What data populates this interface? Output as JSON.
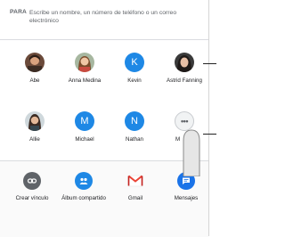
{
  "to_field": {
    "label": "PARA",
    "placeholder": "Escribe un nombre, un número de teléfono o un correo electrónico"
  },
  "contacts": [
    {
      "name": "Abe",
      "avatar": "photo",
      "icon": "person-photo-icon"
    },
    {
      "name": "Anna Medina",
      "avatar": "photo",
      "icon": "person-photo-icon"
    },
    {
      "name": "Kevin",
      "avatar": "letter",
      "letter": "K"
    },
    {
      "name": "Astrid Fanning",
      "avatar": "photo",
      "icon": "person-photo-icon"
    },
    {
      "name": "Allie",
      "avatar": "photo",
      "icon": "person-photo-icon"
    },
    {
      "name": "Michael",
      "avatar": "letter",
      "letter": "M"
    },
    {
      "name": "Nathan",
      "avatar": "letter",
      "letter": "N"
    },
    {
      "name": "M",
      "avatar": "more",
      "glyph": "•••",
      "icon": "more-icon"
    }
  ],
  "apps": [
    {
      "label": "Crear vínculo",
      "icon": "link-icon",
      "color": "#5f6368"
    },
    {
      "label": "Álbum compartido",
      "icon": "shared-album-icon",
      "color": "#1e88e5"
    },
    {
      "label": "Gmail",
      "icon": "gmail-icon",
      "color": "#ea4335"
    },
    {
      "label": "Mensajes",
      "icon": "messages-icon",
      "color": "#1a73e8"
    }
  ],
  "colors": {
    "accent_blue": "#1e88e5",
    "divider": "#dadce0",
    "text_secondary": "#5f6368"
  }
}
